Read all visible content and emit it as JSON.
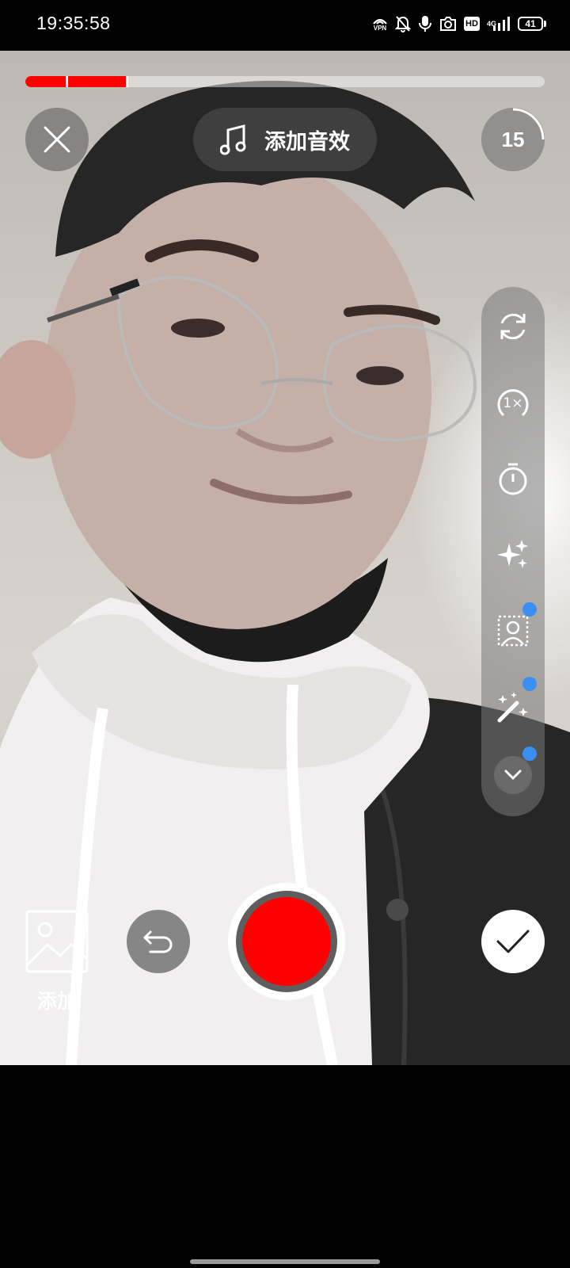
{
  "status_bar": {
    "time": "19:35:58",
    "vpn_label": "VPN",
    "hd_label": "HD",
    "network_label": "4G",
    "battery_level": "41",
    "icons": [
      "vpn-icon",
      "mute-bell-icon",
      "microphone-icon",
      "camera-icon",
      "hd-icon",
      "signal-icon",
      "battery-icon"
    ]
  },
  "recorder": {
    "progress": {
      "fraction": 0.195,
      "segment_marks": [
        0.08,
        0.195
      ]
    },
    "sound_button_label": "添加音效",
    "duration_label": "15",
    "side_tools": [
      "flip-camera-icon",
      "speed-1x-icon",
      "timer-icon",
      "beauty-sparkle-icon",
      "portrait-effect-icon",
      "magic-wand-icon",
      "expand-more-icon"
    ],
    "gallery_label": "添加",
    "colors": {
      "record": "#ff0000",
      "progress": "#ff0000",
      "indicator_dot": "#3b8ff3"
    }
  }
}
